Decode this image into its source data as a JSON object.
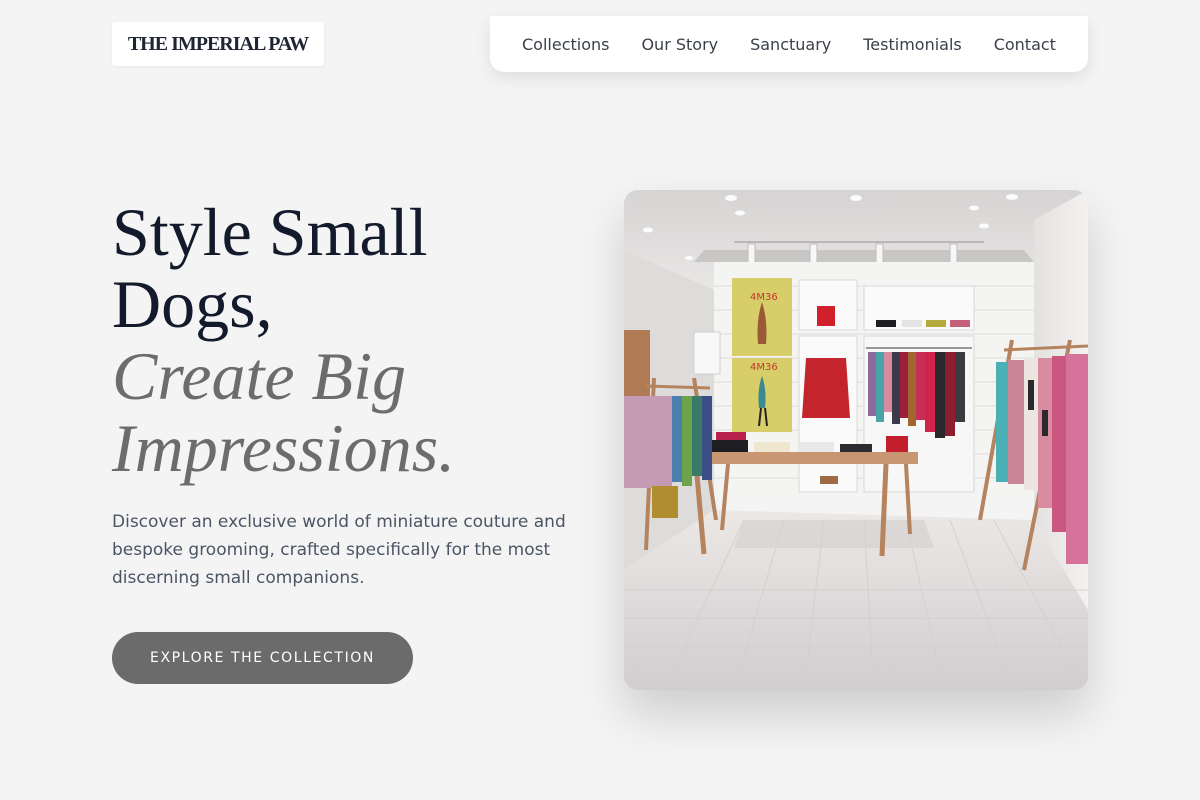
{
  "brand": {
    "logo_text": "THE IMPERIAL PAW"
  },
  "nav": {
    "items": [
      {
        "label": "Collections"
      },
      {
        "label": "Our Story"
      },
      {
        "label": "Sanctuary"
      },
      {
        "label": "Testimonials"
      },
      {
        "label": "Contact"
      }
    ]
  },
  "hero": {
    "headline_line1": "Style Small",
    "headline_line2": "Dogs,",
    "headline_line3": "Create Big",
    "headline_line4": "Impressions.",
    "subtitle": "Discover an exclusive world of miniature couture and bespoke grooming, crafted specifically for the most discerning small companions.",
    "cta_label": "EXPLORE THE COLLECTION",
    "image": {
      "poster_label_1": "4M36",
      "poster_label_2": "4M36"
    }
  },
  "colors": {
    "background": "#f4f4f4",
    "headline": "#131a2c",
    "headline_italic": "#6c6c6c",
    "body_text": "#4b5563",
    "cta_background": "#6b6b6b",
    "cta_text": "#ffffff"
  }
}
